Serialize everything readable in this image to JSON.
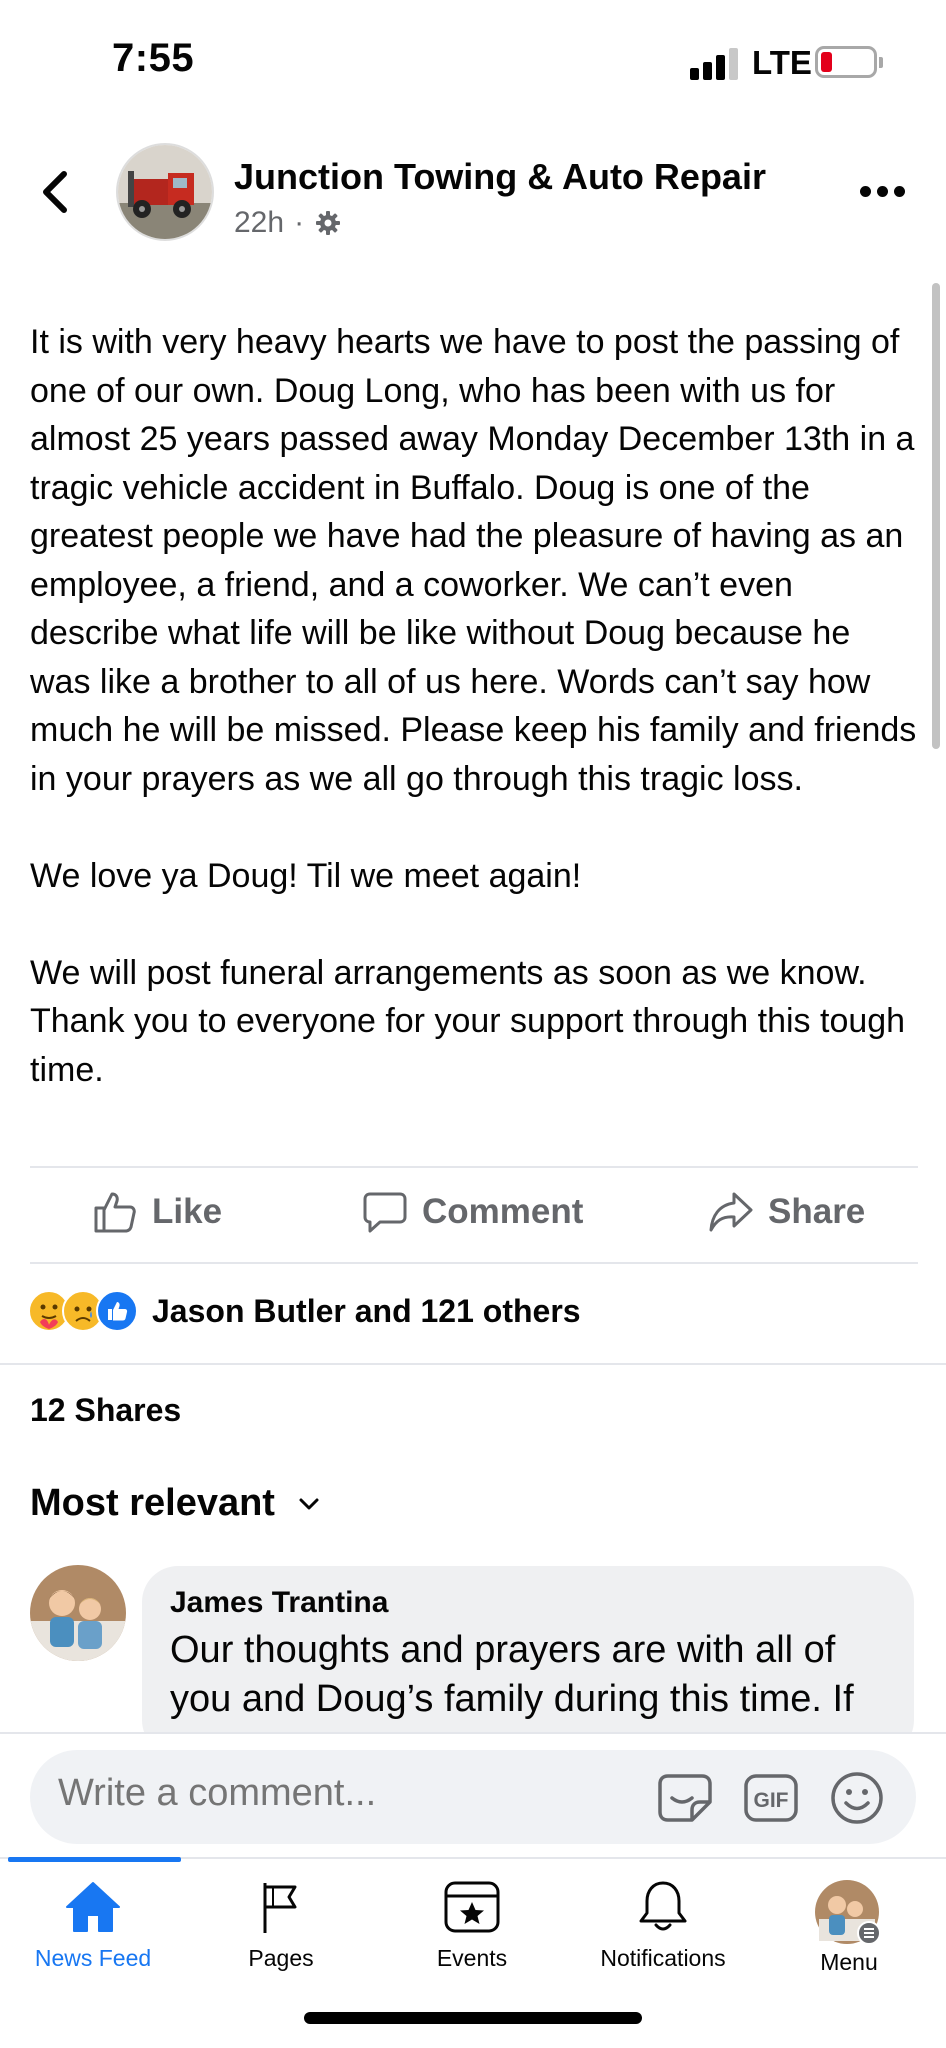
{
  "status_bar": {
    "time": "7:55",
    "network": "LTE"
  },
  "post": {
    "page_name": "Junction Towing & Auto Repair",
    "time_ago": "22h",
    "separator": "·",
    "body": [
      "It is with very heavy hearts we have to post the passing of one of our own. Doug Long, who has been with us for almost 25 years passed away Monday December 13th in a tragic vehicle accident in Buffalo. Doug is one of the greatest people we have had the pleasure of having as an employee, a friend, and a coworker. We can’t even describe what life will be like without Doug because he was like a brother to all of us here. Words can’t say how much he will be missed. Please keep his family and friends in your prayers as we all go through this tragic loss.",
      "We love ya Doug! Til we meet again!",
      "We will post funeral arrangements as soon as we know. Thank you to everyone for your support through this tough time."
    ]
  },
  "actions": {
    "like": "Like",
    "comment": "Comment",
    "share": "Share"
  },
  "reactions": {
    "summary": "Jason Butler and 121 others",
    "icons": [
      "care-icon",
      "sad-icon",
      "like-icon"
    ]
  },
  "shares": "12 Shares",
  "sort": {
    "label": "Most relevant"
  },
  "comments": [
    {
      "author": "James Trantina",
      "text": "Our thoughts and prayers are with all of you and Doug’s family during this time. If you need anything, please call. We are here for you."
    }
  ],
  "compose": {
    "placeholder": "Write a comment...",
    "gif": "GIF"
  },
  "tabs": [
    {
      "label": "News Feed",
      "icon": "home-icon",
      "active": true
    },
    {
      "label": "Pages",
      "icon": "flag-icon"
    },
    {
      "label": "Events",
      "icon": "calendar-star-icon"
    },
    {
      "label": "Notifications",
      "icon": "bell-icon"
    },
    {
      "label": "Menu",
      "icon": "profile-avatar-icon"
    }
  ],
  "colors": {
    "accent": "#1877f2",
    "secondary_text": "#65676b",
    "bubble": "#eff0f2",
    "divider": "#e4e6eb"
  }
}
